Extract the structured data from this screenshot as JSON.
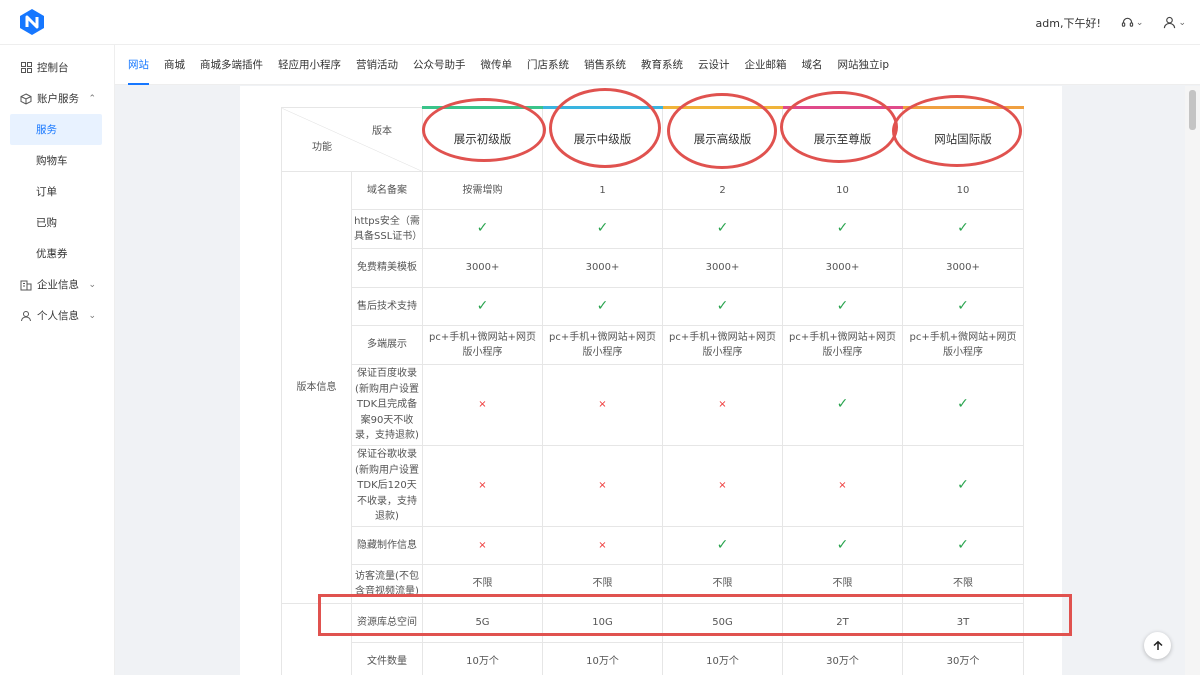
{
  "header": {
    "greeting": "adm,下午好!"
  },
  "colors": {
    "accent": "#1677ff",
    "check": "#2aa44f",
    "cross": "#e33333",
    "highlight": "#e0524f"
  },
  "sidebar": {
    "console": "控制台",
    "account": "账户服务",
    "services": "服务",
    "cart": "购物车",
    "orders": "订单",
    "purchased": "已购",
    "coupons": "优惠券",
    "company": "企业信息",
    "personal": "个人信息"
  },
  "nav": [
    "网站",
    "商城",
    "商城多端插件",
    "轻应用小程序",
    "营销活动",
    "公众号助手",
    "微传单",
    "门店系统",
    "销售系统",
    "教育系统",
    "云设计",
    "企业邮箱",
    "域名",
    "网站独立ip"
  ],
  "table": {
    "header_version": "版本",
    "header_function": "功能",
    "group_label": "版本信息",
    "plans": [
      "展示初级版",
      "展示中级版",
      "展示高级版",
      "展示至尊版",
      "网站国际版"
    ],
    "plan_colors": [
      "#3ac48a",
      "#3ab4e0",
      "#f0b43a",
      "#e04a8a",
      "#f0a040"
    ],
    "rows": [
      {
        "label": "域名备案",
        "cells": [
          "按需增购",
          "1",
          "2",
          "10",
          "10"
        ]
      },
      {
        "label": "https安全（需具备SSL证书）",
        "cells": [
          "✓",
          "✓",
          "✓",
          "✓",
          "✓"
        ]
      },
      {
        "label": "免费精美模板",
        "cells": [
          "3000+",
          "3000+",
          "3000+",
          "3000+",
          "3000+"
        ]
      },
      {
        "label": "售后技术支持",
        "cells": [
          "✓",
          "✓",
          "✓",
          "✓",
          "✓"
        ]
      },
      {
        "label": "多端展示",
        "cells": [
          "pc+手机+微网站+网页版小程序",
          "pc+手机+微网站+网页版小程序",
          "pc+手机+微网站+网页版小程序",
          "pc+手机+微网站+网页版小程序",
          "pc+手机+微网站+网页版小程序"
        ]
      },
      {
        "label": "保证百度收录(新购用户设置TDK且完成备案90天不收录，支持退款)",
        "cells": [
          "×",
          "×",
          "×",
          "✓",
          "✓"
        ]
      },
      {
        "label": "保证谷歌收录(新购用户设置TDK后120天不收录，支持退款)",
        "cells": [
          "×",
          "×",
          "×",
          "×",
          "✓"
        ]
      },
      {
        "label": "隐藏制作信息",
        "cells": [
          "×",
          "×",
          "✓",
          "✓",
          "✓"
        ]
      },
      {
        "label": "访客流量(不包含音视频流量)",
        "cells": [
          "不限",
          "不限",
          "不限",
          "不限",
          "不限"
        ]
      },
      {
        "label": "资源库总空间",
        "cells": [
          "5G",
          "10G",
          "50G",
          "2T",
          "3T"
        ]
      },
      {
        "label": "文件数量",
        "cells": [
          "10万个",
          "10万个",
          "10万个",
          "30万个",
          "30万个"
        ]
      }
    ]
  }
}
